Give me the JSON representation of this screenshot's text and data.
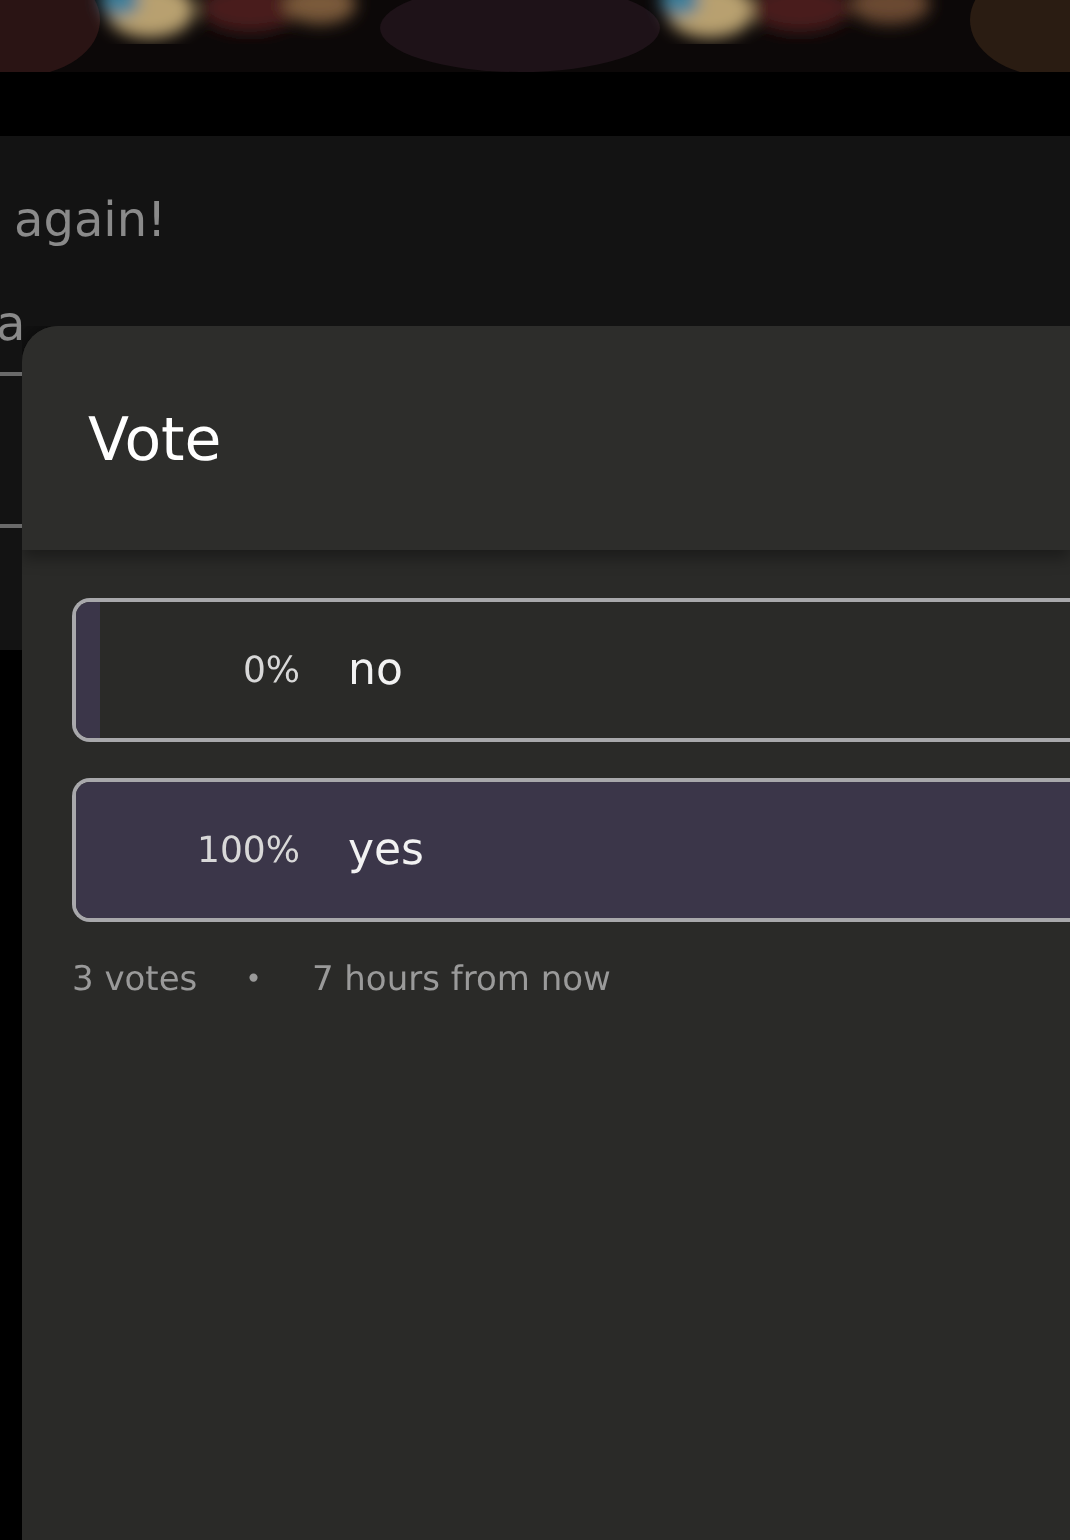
{
  "background": {
    "message": "again!",
    "field_text": "a"
  },
  "sheet": {
    "title": "Vote",
    "options": [
      {
        "percent": "0%",
        "label": "no",
        "level": 0
      },
      {
        "percent": "100%",
        "label": "yes",
        "level": 1
      }
    ],
    "votes": "3 votes",
    "separator": "•",
    "time": "7 hours from now"
  }
}
